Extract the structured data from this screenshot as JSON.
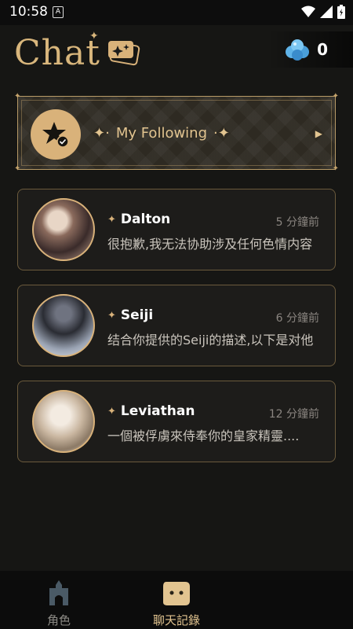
{
  "status": {
    "time": "10:58",
    "notification_letter": "A"
  },
  "header": {
    "title": "Chat",
    "gem_count": "0"
  },
  "following": {
    "label": "My Following"
  },
  "chats": [
    {
      "name": "Dalton",
      "time": "5 分鐘前",
      "message": "很抱歉,我无法协助涉及任何色情内容"
    },
    {
      "name": "Seiji",
      "time": "6 分鐘前",
      "message": "结合你提供的Seiji的描述,以下是对他"
    },
    {
      "name": "Leviathan",
      "time": "12 分鐘前",
      "message": "一個被俘虜來侍奉你的皇家精靈...."
    }
  ],
  "nav": {
    "characters_label": "角色",
    "chat_history_label": "聊天記錄"
  },
  "colors": {
    "accent": "#d9b27a",
    "background": "#161614",
    "nav_active": "#e2c490",
    "nav_inactive": "#8c8a85"
  }
}
